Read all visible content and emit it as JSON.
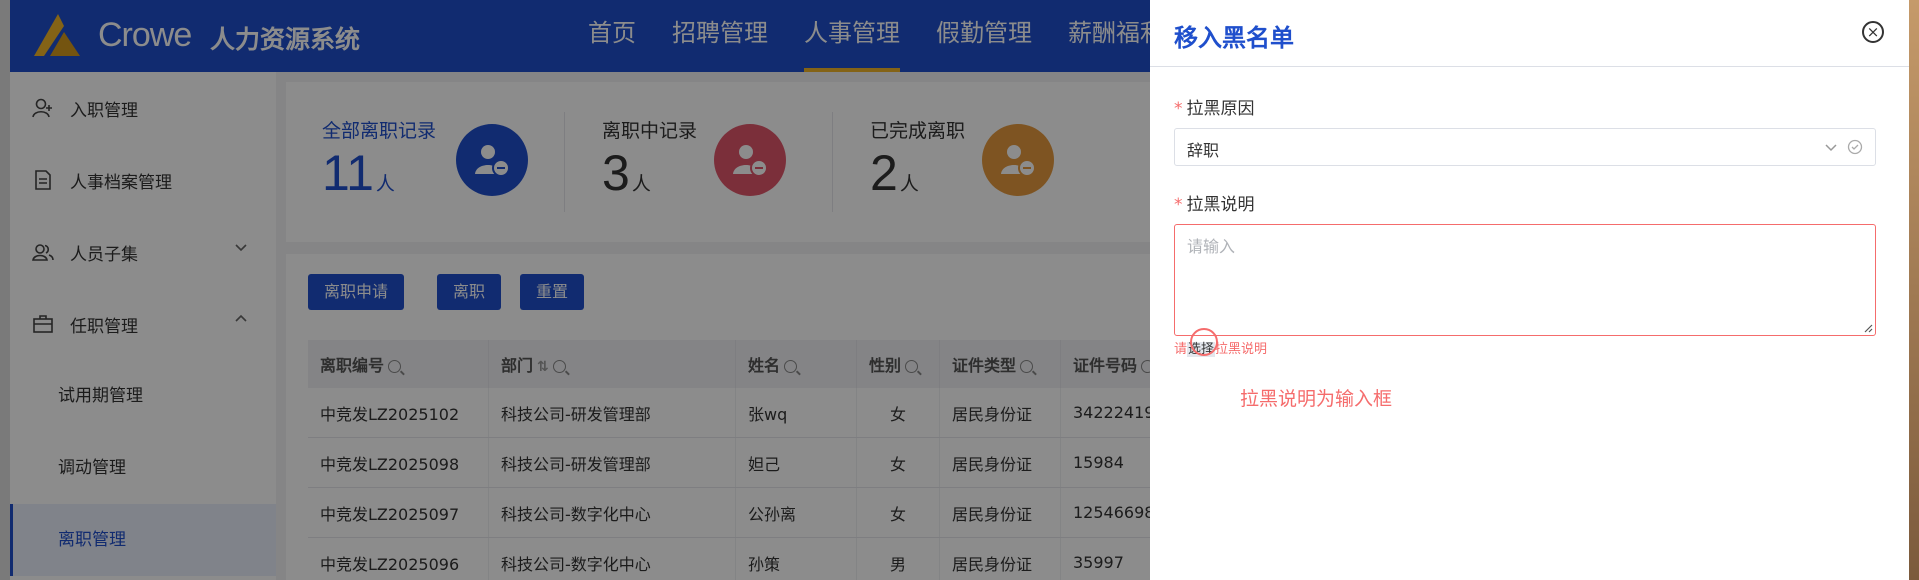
{
  "header": {
    "brand": "Crowe",
    "brand_cn": "人力资源系统",
    "nav": [
      "首页",
      "招聘管理",
      "人事管理",
      "假勤管理",
      "薪酬福利"
    ],
    "active_nav": "人事管理"
  },
  "sidebar": {
    "items": [
      {
        "label": "入职管理",
        "icon": "user-add-icon"
      },
      {
        "label": "人事档案管理",
        "icon": "document-icon"
      },
      {
        "label": "人员子集",
        "icon": "users-icon"
      },
      {
        "label": "任职管理",
        "icon": "briefcase-icon"
      }
    ],
    "sub_items": [
      "试用期管理",
      "调动管理",
      "离职管理"
    ],
    "active_sub": "离职管理"
  },
  "stats": [
    {
      "label": "全部离职记录",
      "value": "11",
      "unit": "人",
      "color": "#1f4fcc"
    },
    {
      "label": "离职中记录",
      "value": "3",
      "unit": "人",
      "color": "#e0566b"
    },
    {
      "label": "已完成离职",
      "value": "2",
      "unit": "人",
      "color": "#e59a3e"
    }
  ],
  "toolbar": {
    "apply_label": "离职申请",
    "resign_label": "离职",
    "reset_label": "重置"
  },
  "table": {
    "columns": [
      "离职编号",
      "部门",
      "姓名",
      "性别",
      "证件类型",
      "证件号码"
    ],
    "rows": [
      [
        "中竞发LZ2025102",
        "科技公司-研发管理部",
        "张wq",
        "女",
        "居民身份证",
        "34222419"
      ],
      [
        "中竞发LZ2025098",
        "科技公司-研发管理部",
        "妲己",
        "女",
        "居民身份证",
        "15984"
      ],
      [
        "中竞发LZ2025097",
        "科技公司-数字化中心",
        "公孙离",
        "女",
        "居民身份证",
        "12546698"
      ],
      [
        "中竞发LZ2025096",
        "科技公司-数字化中心",
        "孙策",
        "男",
        "居民身份证",
        "35997"
      ]
    ]
  },
  "drawer": {
    "title": "移入黑名单",
    "reason_label": "拉黑原因",
    "reason_value": "辞职",
    "desc_label": "拉黑说明",
    "desc_placeholder": "请输入",
    "error_prefix": "请",
    "error_tag": "选择",
    "error_suffix": "拉黑说明",
    "annotation": "拉黑说明为输入框"
  }
}
